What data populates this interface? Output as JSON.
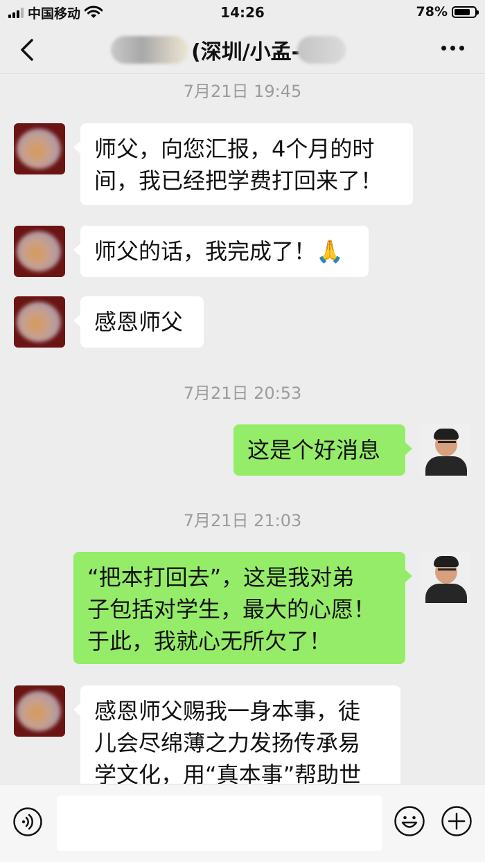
{
  "status_bar": {
    "carrier": "中国移动",
    "time": "14:26",
    "battery_percent": "78%",
    "battery_level": 0.78
  },
  "nav": {
    "title": "(深圳/小孟-"
  },
  "messages": [
    {
      "type": "timestamp",
      "text": "7月21日 19:45"
    },
    {
      "type": "message",
      "sender": "them",
      "lines": [
        "师父，向您汇报，4个月的时",
        "间，我已经把学费打回来了！"
      ]
    },
    {
      "type": "message",
      "sender": "them",
      "lines": [
        "师父的话，我完成了！🙏"
      ]
    },
    {
      "type": "message",
      "sender": "them",
      "lines": [
        "感恩师父"
      ]
    },
    {
      "type": "timestamp",
      "text": "7月21日 20:53"
    },
    {
      "type": "message",
      "sender": "me",
      "lines": [
        "这是个好消息"
      ]
    },
    {
      "type": "timestamp",
      "text": "7月21日 21:03"
    },
    {
      "type": "message",
      "sender": "me",
      "lines": [
        "“把本打回去”，这是我对弟",
        "子包括对学生，最大的心愿！",
        "于此，我就心无所欠了！"
      ]
    },
    {
      "type": "message",
      "sender": "them",
      "lines": [
        "感恩师父赐我一身本事，徒",
        "儿会尽绵薄之力发扬传承易",
        "学文化，用“真本事”帮助世"
      ]
    }
  ],
  "input": {
    "placeholder": ""
  },
  "icons": {
    "back": "chevron-left-icon",
    "more": "more-icon",
    "voice": "voice-icon",
    "emoji": "emoji-icon",
    "plus": "plus-icon"
  },
  "colors": {
    "background": "#ededed",
    "my_bubble": "#95ec69",
    "their_bubble": "#ffffff",
    "timestamp": "#9b9b9b"
  }
}
